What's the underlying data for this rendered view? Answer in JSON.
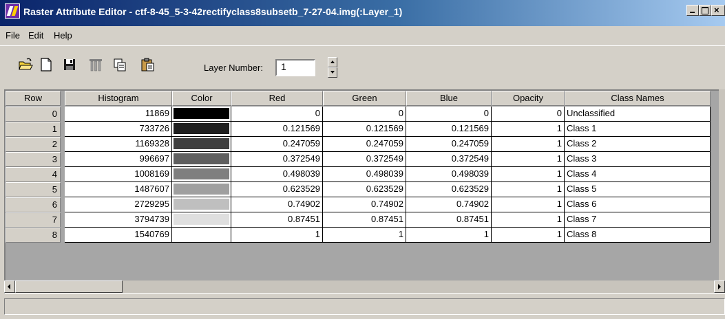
{
  "window": {
    "title": "Raster Attribute Editor - ctf-8-45_5-3-42rectifyclass8subsetb_7-27-04.img(:Layer_1)"
  },
  "menu": [
    "File",
    "Edit",
    "Help"
  ],
  "toolbar": {
    "icons": [
      "open-folder-icon",
      "new-file-icon",
      "save-icon",
      "column-properties-icon",
      "copy-icon",
      "paste-icon"
    ],
    "layer_label": "Layer Number:",
    "layer_value": "1"
  },
  "table": {
    "columns": [
      "Row",
      "Histogram",
      "Color",
      "Red",
      "Green",
      "Blue",
      "Opacity",
      "Class Names"
    ],
    "rows": [
      {
        "row": "0",
        "histogram": "11869",
        "color": "#000000",
        "red": "0",
        "green": "0",
        "blue": "0",
        "opacity": "0",
        "class_name": "Unclassified"
      },
      {
        "row": "1",
        "histogram": "733726",
        "color": "#1f1f1f",
        "red": "0.121569",
        "green": "0.121569",
        "blue": "0.121569",
        "opacity": "1",
        "class_name": "Class 1"
      },
      {
        "row": "2",
        "histogram": "1169328",
        "color": "#3f3f3f",
        "red": "0.247059",
        "green": "0.247059",
        "blue": "0.247059",
        "opacity": "1",
        "class_name": "Class 2"
      },
      {
        "row": "3",
        "histogram": "996697",
        "color": "#5f5f5f",
        "red": "0.372549",
        "green": "0.372549",
        "blue": "0.372549",
        "opacity": "1",
        "class_name": "Class 3"
      },
      {
        "row": "4",
        "histogram": "1008169",
        "color": "#7f7f7f",
        "red": "0.498039",
        "green": "0.498039",
        "blue": "0.498039",
        "opacity": "1",
        "class_name": "Class 4"
      },
      {
        "row": "5",
        "histogram": "1487607",
        "color": "#9f9f9f",
        "red": "0.623529",
        "green": "0.623529",
        "blue": "0.623529",
        "opacity": "1",
        "class_name": "Class 5"
      },
      {
        "row": "6",
        "histogram": "2729295",
        "color": "#bfbfbf",
        "red": "0.74902",
        "green": "0.74902",
        "blue": "0.74902",
        "opacity": "1",
        "class_name": "Class 6"
      },
      {
        "row": "7",
        "histogram": "3794739",
        "color": "#dfdfdf",
        "red": "0.87451",
        "green": "0.87451",
        "blue": "0.87451",
        "opacity": "1",
        "class_name": "Class 7"
      },
      {
        "row": "8",
        "histogram": "1540769",
        "color": "#ffffff",
        "red": "1",
        "green": "1",
        "blue": "1",
        "opacity": "1",
        "class_name": "Class 8"
      }
    ]
  }
}
